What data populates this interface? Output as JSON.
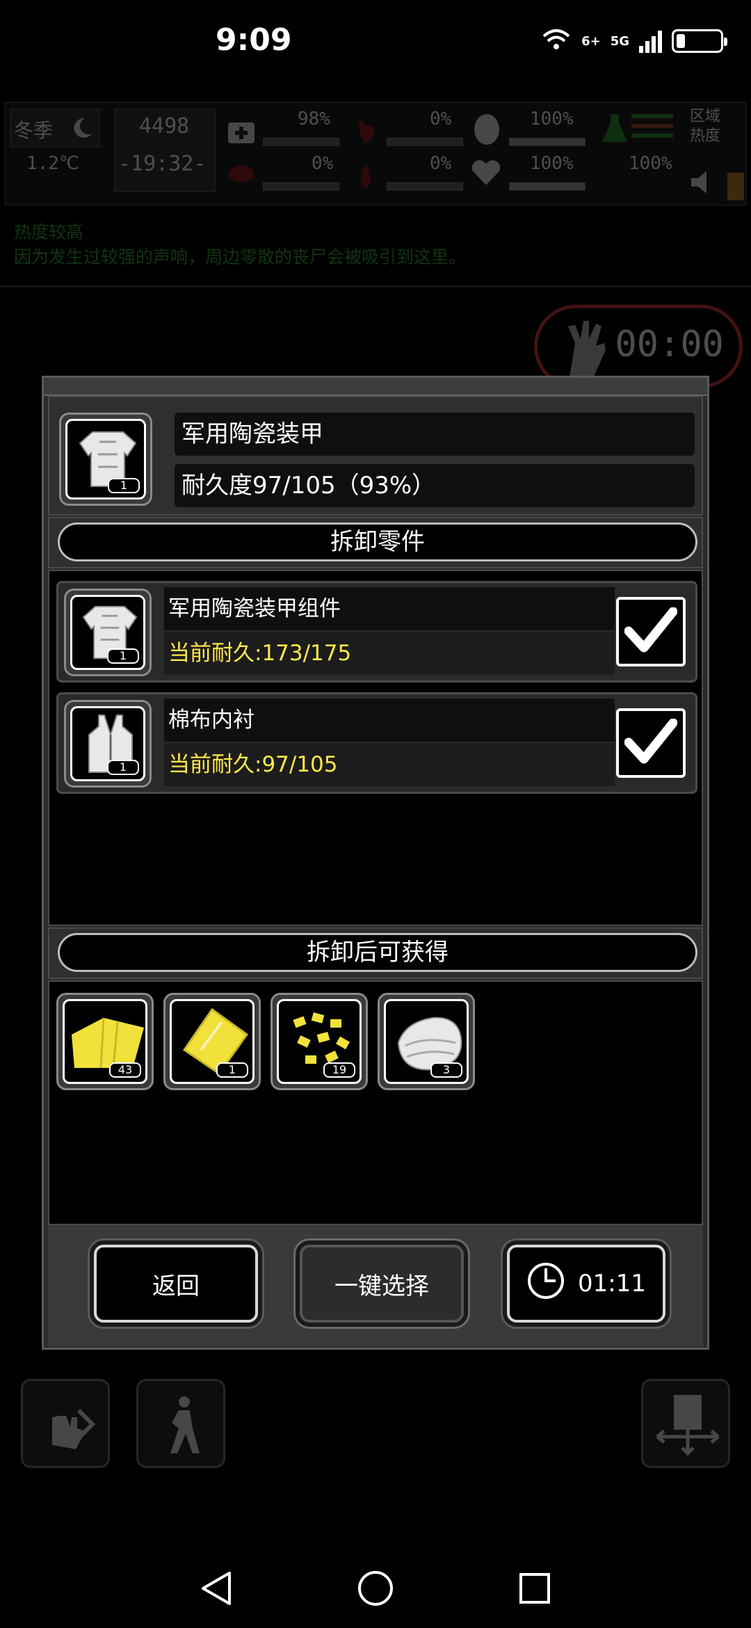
{
  "status_bar": {
    "time": "9:09",
    "wifi_label": "6+",
    "network_label": "5G",
    "battery_level": 0.2
  },
  "hud": {
    "season": "冬季",
    "temperature": "1.2℃",
    "day": "4498",
    "clock": "-19:32-",
    "stat_1": "98%",
    "stat_2": "0%",
    "stat_3": "100%",
    "stat_4": "0%",
    "stat_5": "0%",
    "stat_6": "100%",
    "stat_7": "100%",
    "zone_label": "区域热度"
  },
  "background": {
    "notice_title": "热度较高",
    "notice_body": "因为发生过较强的声响，周边零散的丧尸会被吸引到这里。",
    "timer": "00:00"
  },
  "dialog": {
    "item_name": "军用陶瓷装甲",
    "item_durability": "耐久度97/105（93%）",
    "item_count": "1",
    "parts_header": "拆卸零件",
    "parts": [
      {
        "name": "军用陶瓷装甲组件",
        "durability": "当前耐久:173/175",
        "count": "1",
        "icon": "armor-icon",
        "checked": true
      },
      {
        "name": "棉布内衬",
        "durability": "当前耐久:97/105",
        "count": "1",
        "icon": "vest-icon",
        "checked": true
      }
    ],
    "rewards_header": "拆卸后可获得",
    "rewards": [
      {
        "icon": "cloth-icon",
        "count": "43"
      },
      {
        "icon": "plate-icon",
        "count": "1"
      },
      {
        "icon": "scraps-icon",
        "count": "19"
      },
      {
        "icon": "fabric-icon",
        "count": "3"
      }
    ],
    "back_label": "返回",
    "select_all_label": "一键选择",
    "timer_label": "01:11"
  },
  "colors": {
    "durability_text": "#ffe94a",
    "reward_yellow": "#f2e13a",
    "zone_red": "#b03030"
  }
}
